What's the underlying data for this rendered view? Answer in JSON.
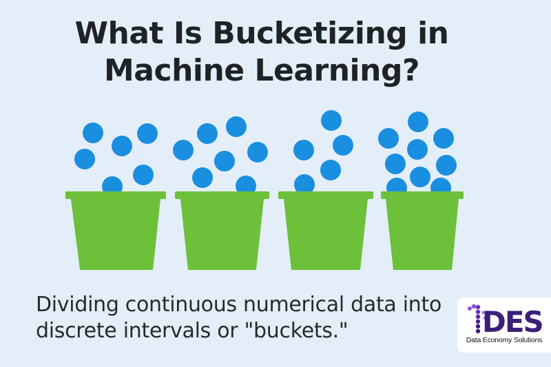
{
  "title": "What Is Bucketizing in Machine Learning?",
  "subtitle": "Dividing continuous numerical data into discrete intervals or \"buckets.\"",
  "logo": {
    "mark_text": "DES",
    "caption": "Data Economy Solutions"
  },
  "colors": {
    "background": "#e3eef8",
    "bucket": "#6cc03a",
    "ball": "#1a8fe0",
    "logo_mark": "#3b1f78",
    "logo_accent": "#8e4fd6"
  }
}
